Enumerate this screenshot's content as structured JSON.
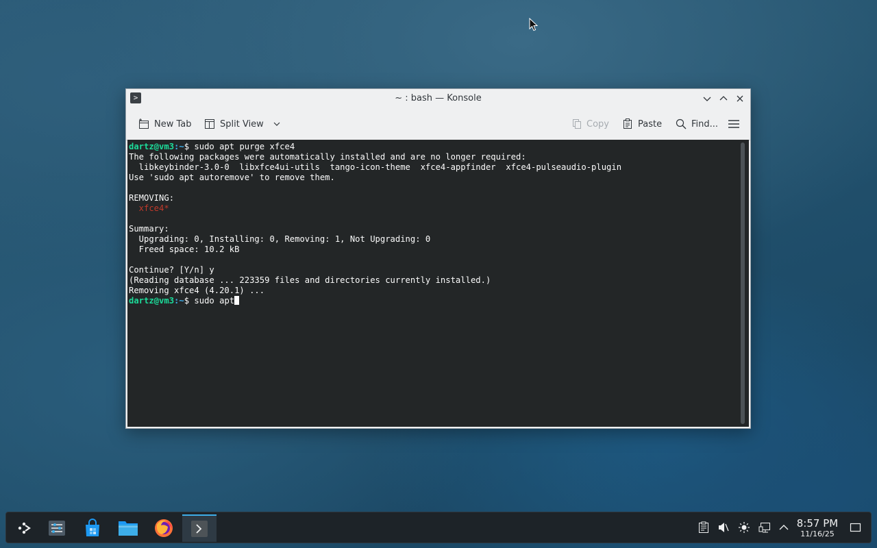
{
  "window": {
    "title": "~ : bash — Konsole",
    "app_icon": "konsole-icon"
  },
  "toolbar": {
    "new_tab_label": "New Tab",
    "split_view_label": "Split View",
    "copy_label": "Copy",
    "paste_label": "Paste",
    "find_label": "Find..."
  },
  "terminal": {
    "prompt_user": "dartz@vm3",
    "prompt_path": "~",
    "command1": "sudo apt purge xfce4",
    "line1": "The following packages were automatically installed and are no longer required:",
    "line2": "  libkeybinder-3.0-0  libxfce4ui-utils  tango-icon-theme  xfce4-appfinder  xfce4-pulseaudio-plugin",
    "line3": "Use 'sudo apt autoremove' to remove them.",
    "line4": "REMOVING:",
    "line5": "  xfce4*",
    "line6": "Summary:",
    "line7": "  Upgrading: 0, Installing: 0, Removing: 1, Not Upgrading: 0",
    "line8": "  Freed space: 10.2 kB",
    "line9": "Continue? [Y/n] y",
    "line10": "(Reading database ... 223359 files and directories currently installed.)",
    "line11": "Removing xfce4 (4.20.1) ...",
    "command2": "sudo apt"
  },
  "taskbar": {
    "items": [
      {
        "name": "application-launcher-icon"
      },
      {
        "name": "system-settings-icon"
      },
      {
        "name": "discover-store-icon"
      },
      {
        "name": "dolphin-file-manager-icon"
      },
      {
        "name": "firefox-icon"
      },
      {
        "name": "konsole-task-icon"
      }
    ],
    "clock": {
      "time": "8:57 PM",
      "date": "11/16/25"
    }
  },
  "colors": {
    "accent": "#3daee9",
    "terminal_bg": "#232627",
    "prompt_user": "#1cdc9a",
    "removing_red": "#c0392b"
  }
}
